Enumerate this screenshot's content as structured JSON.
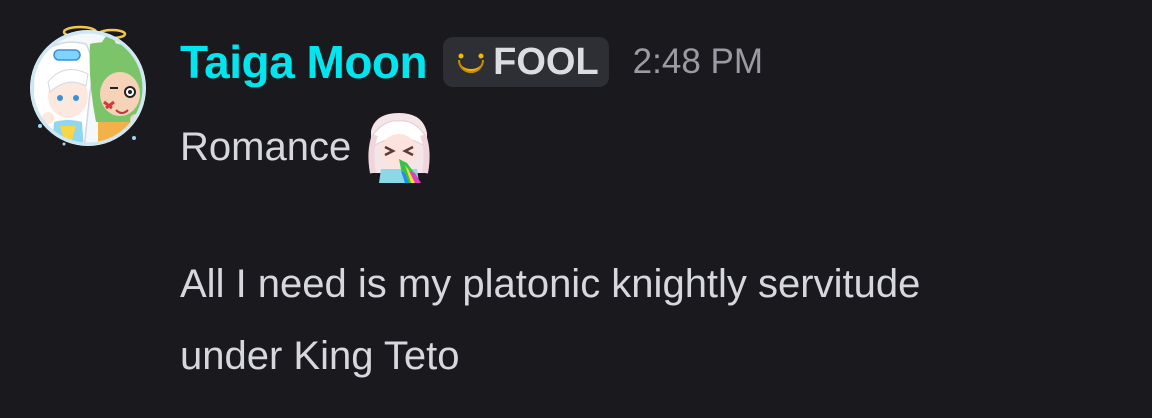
{
  "author": {
    "name": "Taiga Moon",
    "name_color": "#00e5ee"
  },
  "role_tag": {
    "icon": "crescent-moon-icon",
    "icon_color": "#f0b800",
    "label": "FOOL"
  },
  "timestamp": "2:48 PM",
  "message": {
    "line1": "Romance",
    "emoji": "anime-girl-rainbow-vomit-emoji",
    "line2": "All I need is my platonic knightly servitude",
    "line3": "under King Teto"
  },
  "colors": {
    "background": "#1a1a1e",
    "text": "#d7d8dd",
    "tag_background": "#2e2f35",
    "timestamp": "#9a9ba3"
  }
}
